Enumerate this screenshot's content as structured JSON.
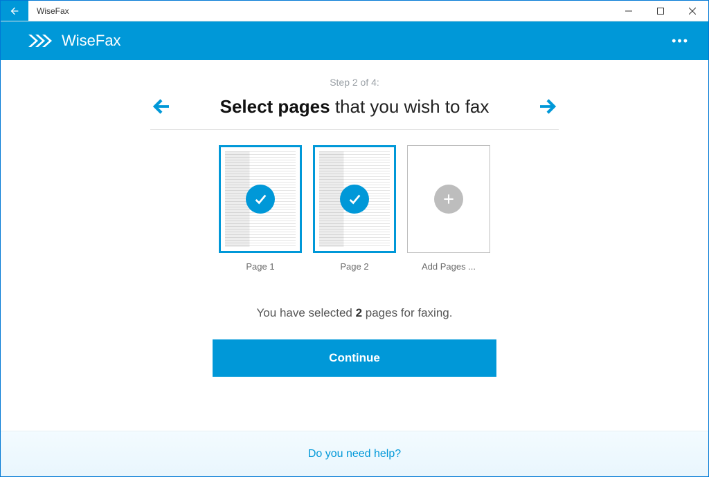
{
  "window": {
    "title": "WiseFax"
  },
  "header": {
    "brand": "WiseFax"
  },
  "wizard": {
    "step_label": "Step 2 of 4:",
    "heading_strong": "Select pages",
    "heading_rest": " that you wish to fax"
  },
  "thumbs": {
    "page1": "Page 1",
    "page2": "Page 2",
    "add": "Add Pages ..."
  },
  "summary": {
    "prefix": "You have selected ",
    "count": "2",
    "suffix": " pages for faxing."
  },
  "actions": {
    "continue": "Continue"
  },
  "footer": {
    "help": "Do you need help?"
  }
}
